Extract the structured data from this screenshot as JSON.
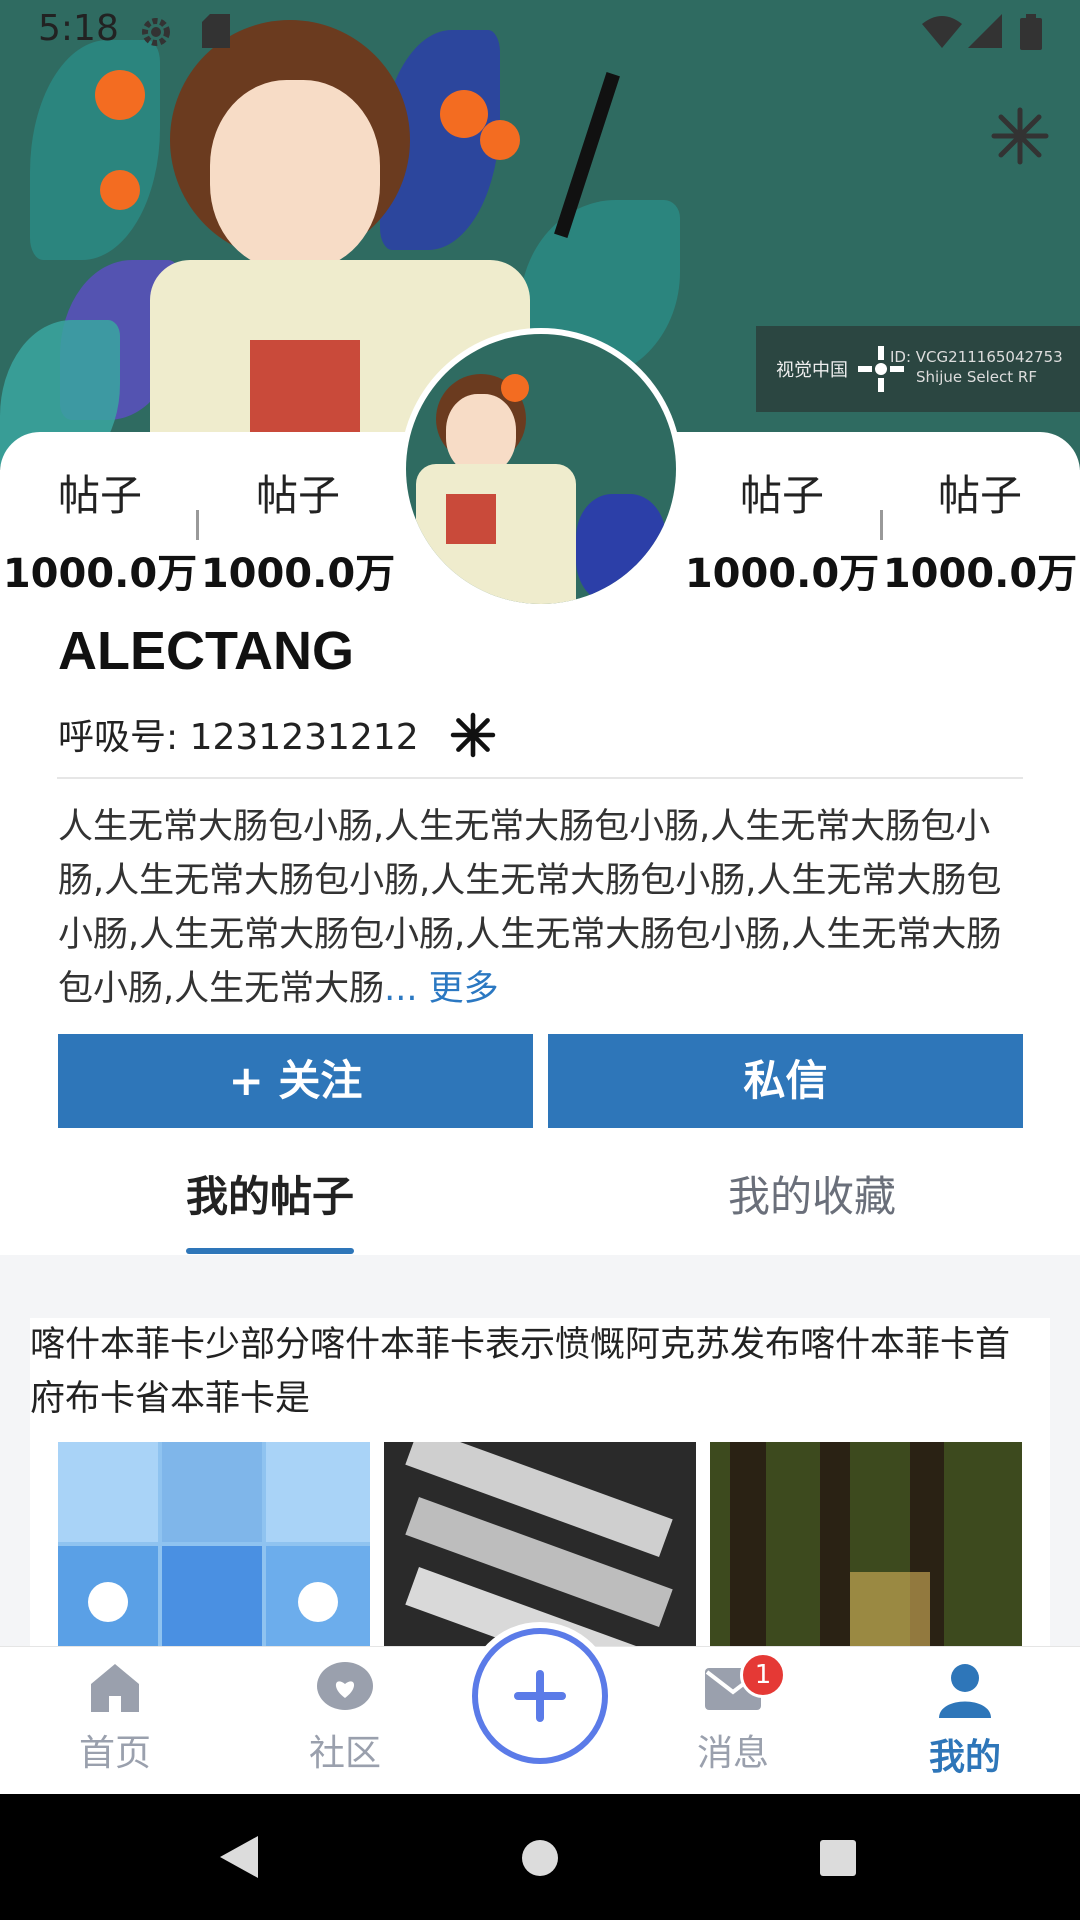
{
  "status_bar": {
    "time": "5:18"
  },
  "banner": {
    "watermark_id": "ID: VCG211165042753",
    "watermark_sub": "Shijue Select RF",
    "watermark_brand": "视觉中国"
  },
  "stats": [
    {
      "label": "帖子",
      "value": "1000.0万"
    },
    {
      "label": "帖子",
      "value": "1000.0万"
    },
    {
      "label": "帖子",
      "value": "1000.0万"
    },
    {
      "label": "帖子",
      "value": "1000.0万"
    }
  ],
  "profile": {
    "name": "ALECTANG",
    "id_line": "呼吸号: 1231231212",
    "bio": "人生无常大肠包小肠,人生无常大肠包小肠,人生无常大肠包小肠,人生无常大肠包小肠,人生无常大肠包小肠,人生无常大肠包小肠,人生无常大肠包小肠,人生无常大肠包小肠,人生无常大肠包小肠,人生无常大肠",
    "more": "... 更多"
  },
  "actions": {
    "follow": "+ 关注",
    "message": "私信"
  },
  "tabs": [
    {
      "label": "我的帖子",
      "active": true
    },
    {
      "label": "我的收藏",
      "active": false
    }
  ],
  "post": {
    "text": "喀什本菲卡少部分喀什本菲卡表示愤慨阿克苏发布喀什本菲卡首府布卡省本菲卡是"
  },
  "nav": {
    "items": [
      {
        "label": "首页",
        "icon": "home-icon"
      },
      {
        "label": "社区",
        "icon": "community-icon"
      },
      {
        "label": "消息",
        "icon": "message-icon",
        "badge": "1"
      },
      {
        "label": "我的",
        "icon": "profile-icon",
        "active": true
      }
    ]
  },
  "colors": {
    "accent": "#2e76b9",
    "fab": "#5b7be8",
    "badge": "#e53935",
    "banner": "#2f6b61"
  }
}
